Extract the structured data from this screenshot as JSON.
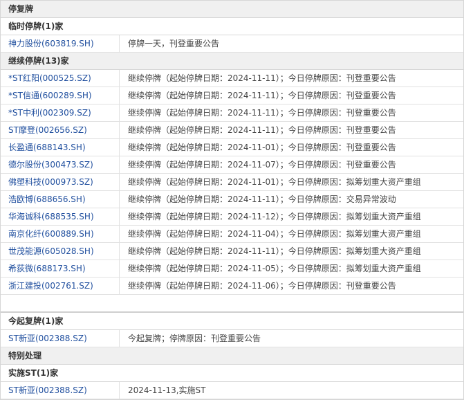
{
  "section1": {
    "title": "停复牌",
    "temp_header": "临时停牌(1)家",
    "temp_rows": [
      {
        "stock": "神力股份(603819.SH)",
        "info": "停牌一天，刊登重要公告"
      }
    ],
    "cont_header": "继续停牌(13)家",
    "cont_rows": [
      {
        "stock": "*ST红阳(000525.SZ)",
        "info": "继续停牌（起始停牌日期：2024-11-11）；今日停牌原因：刊登重要公告"
      },
      {
        "stock": "*ST信通(600289.SH)",
        "info": "继续停牌（起始停牌日期：2024-11-11）；今日停牌原因：刊登重要公告"
      },
      {
        "stock": "*ST中利(002309.SZ)",
        "info": "继续停牌（起始停牌日期：2024-11-11）；今日停牌原因：刊登重要公告"
      },
      {
        "stock": "ST摩登(002656.SZ)",
        "info": "继续停牌（起始停牌日期：2024-11-11）；今日停牌原因：刊登重要公告"
      },
      {
        "stock": "长盈通(688143.SH)",
        "info": "继续停牌（起始停牌日期：2024-11-01）；今日停牌原因：刊登重要公告"
      },
      {
        "stock": "德尔股份(300473.SZ)",
        "info": "继续停牌（起始停牌日期：2024-11-07）；今日停牌原因：刊登重要公告"
      },
      {
        "stock": "佛塑科技(000973.SZ)",
        "info": "继续停牌（起始停牌日期：2024-11-01）；今日停牌原因：拟筹划重大资产重组"
      },
      {
        "stock": "浩欧博(688656.SH)",
        "info": "继续停牌（起始停牌日期：2024-11-11）；今日停牌原因：交易异常波动"
      },
      {
        "stock": "华海诚科(688535.SH)",
        "info": "继续停牌（起始停牌日期：2024-11-12）；今日停牌原因：拟筹划重大资产重组"
      },
      {
        "stock": "南京化纤(600889.SH)",
        "info": "继续停牌（起始停牌日期：2024-11-04）；今日停牌原因：拟筹划重大资产重组"
      },
      {
        "stock": "世茂能源(605028.SH)",
        "info": "继续停牌（起始停牌日期：2024-11-11）；今日停牌原因：拟筹划重大资产重组"
      },
      {
        "stock": "希荻微(688173.SH)",
        "info": "继续停牌（起始停牌日期：2024-11-05）；今日停牌原因：拟筹划重大资产重组"
      },
      {
        "stock": "浙江建投(002761.SZ)",
        "info": "继续停牌（起始停牌日期：2024-11-06）；今日停牌原因：刊登重要公告"
      }
    ],
    "resume_header": "今起复牌(1)家",
    "resume_rows": [
      {
        "stock": "ST新亚(002388.SZ)",
        "info": "今起复牌；停牌原因：刊登重要公告"
      }
    ]
  },
  "section2": {
    "title": "特别处理",
    "st_header": "实施ST(1)家",
    "st_rows": [
      {
        "stock": "ST新亚(002388.SZ)",
        "info": "2024-11-13,实施ST"
      }
    ]
  }
}
